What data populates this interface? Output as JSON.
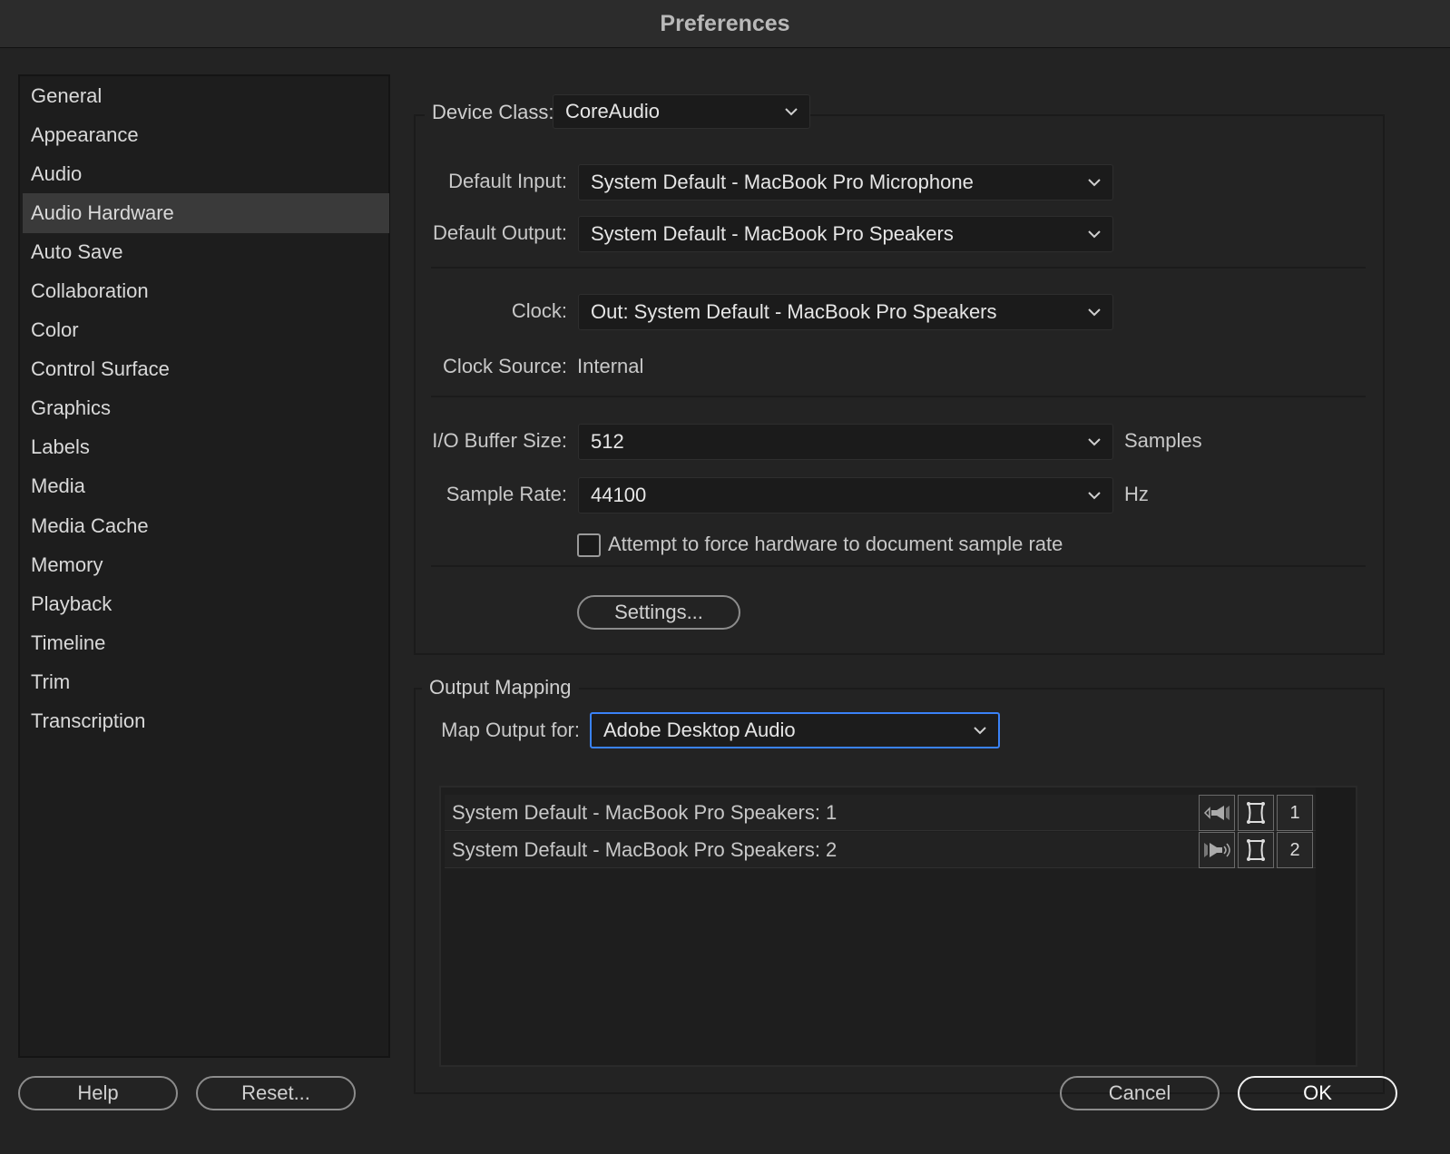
{
  "window": {
    "title": "Preferences"
  },
  "sidebar": {
    "active_index": 3,
    "items": [
      {
        "label": "General"
      },
      {
        "label": "Appearance"
      },
      {
        "label": "Audio"
      },
      {
        "label": "Audio Hardware"
      },
      {
        "label": "Auto Save"
      },
      {
        "label": "Collaboration"
      },
      {
        "label": "Color"
      },
      {
        "label": "Control Surface"
      },
      {
        "label": "Graphics"
      },
      {
        "label": "Labels"
      },
      {
        "label": "Media"
      },
      {
        "label": "Media Cache"
      },
      {
        "label": "Memory"
      },
      {
        "label": "Playback"
      },
      {
        "label": "Timeline"
      },
      {
        "label": "Trim"
      },
      {
        "label": "Transcription"
      }
    ]
  },
  "device": {
    "device_class_label": "Device Class:",
    "device_class_value": "CoreAudio",
    "default_input_label": "Default Input:",
    "default_input_value": "System Default - MacBook Pro Microphone",
    "default_output_label": "Default Output:",
    "default_output_value": "System Default - MacBook Pro Speakers",
    "clock_label": "Clock:",
    "clock_value": "Out: System Default - MacBook Pro Speakers",
    "clock_source_label": "Clock Source:",
    "clock_source_value": "Internal",
    "buffer_label": "I/O Buffer Size:",
    "buffer_value": "512",
    "buffer_unit": "Samples",
    "sample_rate_label": "Sample Rate:",
    "sample_rate_value": "44100",
    "sample_rate_unit": "Hz",
    "force_rate_label": "Attempt to force hardware to document sample rate",
    "force_rate_checked": false,
    "settings_button": "Settings..."
  },
  "output_mapping": {
    "legend": "Output Mapping",
    "map_for_label": "Map Output for:",
    "map_for_value": "Adobe Desktop Audio",
    "channels": [
      {
        "name": "System Default - MacBook Pro Speakers: 1",
        "number": "1"
      },
      {
        "name": "System Default - MacBook Pro Speakers: 2",
        "number": "2"
      }
    ]
  },
  "footer": {
    "help": "Help",
    "reset": "Reset...",
    "cancel": "Cancel",
    "ok": "OK"
  },
  "colors": {
    "accent": "#3a82f7",
    "sidebar_selected": "#3a3a3a",
    "background": "#232323"
  }
}
